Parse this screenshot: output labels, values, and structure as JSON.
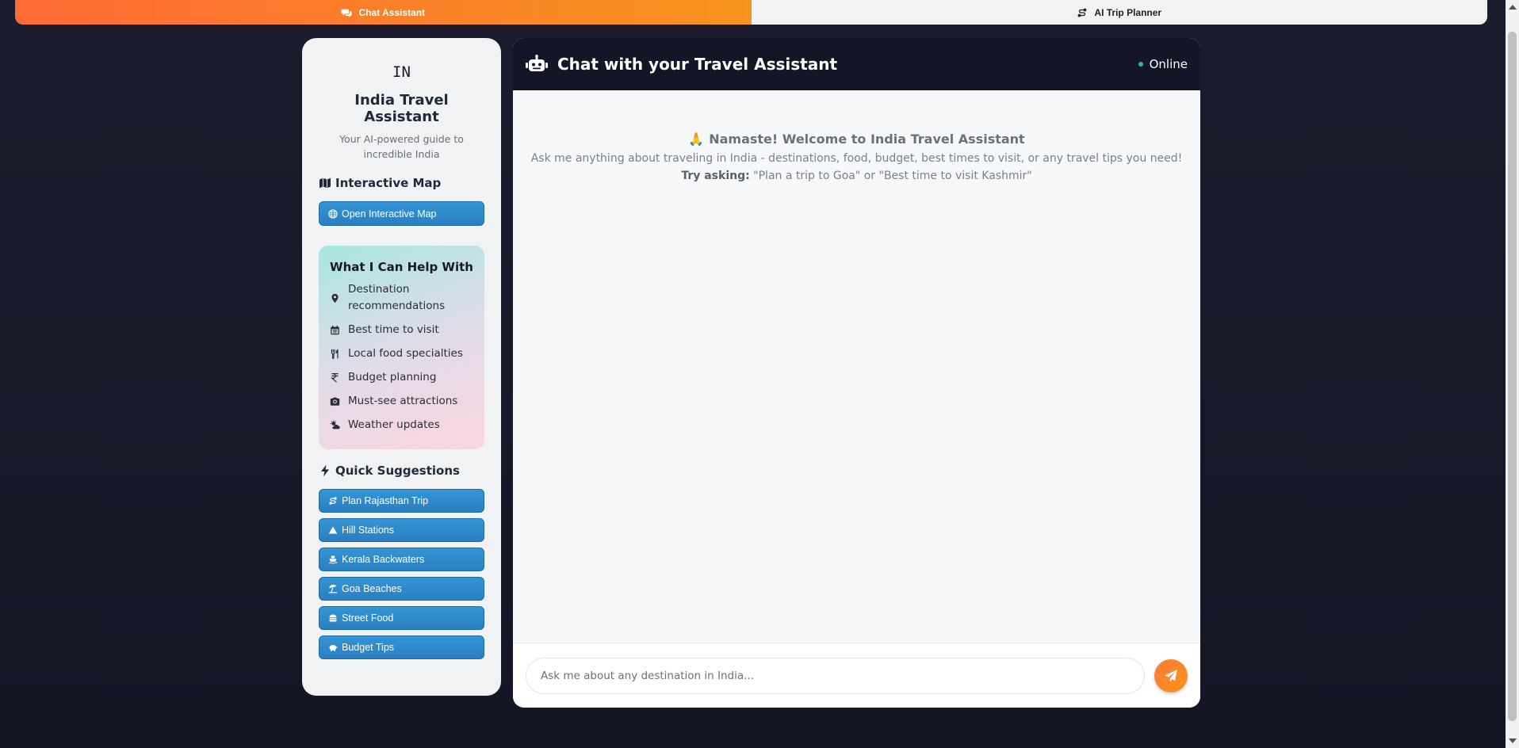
{
  "tabs": [
    {
      "label": "Chat Assistant",
      "icon": "comments-icon",
      "active": true
    },
    {
      "label": "AI Trip Planner",
      "icon": "route-icon",
      "active": false
    }
  ],
  "sidebar": {
    "logo": "IN",
    "title": "India Travel Assistant",
    "subtitle": "Your AI-powered guide to incredible India",
    "map_heading": "Interactive Map",
    "map_button": "Open Interactive Map",
    "help_title": "What I Can Help With",
    "help_items": [
      {
        "icon": "map-pin-icon",
        "label": "Destination recommendations"
      },
      {
        "icon": "calendar-icon",
        "label": "Best time to visit"
      },
      {
        "icon": "utensils-icon",
        "label": "Local food specialties"
      },
      {
        "icon": "rupee-icon",
        "label": "Budget planning"
      },
      {
        "icon": "camera-icon",
        "label": "Must-see attractions"
      },
      {
        "icon": "cloud-sun-icon",
        "label": "Weather updates"
      }
    ],
    "quick_heading": "Quick Suggestions",
    "quick_items": [
      {
        "icon": "route-icon",
        "label": "Plan Rajasthan Trip"
      },
      {
        "icon": "mountain-icon",
        "label": "Hill Stations"
      },
      {
        "icon": "ship-icon",
        "label": "Kerala Backwaters"
      },
      {
        "icon": "umbrella-beach-icon",
        "label": "Goa Beaches"
      },
      {
        "icon": "hamburger-icon",
        "label": "Street Food"
      },
      {
        "icon": "piggy-bank-icon",
        "label": "Budget Tips"
      }
    ]
  },
  "chat": {
    "title": "Chat with your Travel Assistant",
    "status": "Online",
    "welcome_emoji": "🙏",
    "welcome_title": "Namaste! Welcome to India Travel Assistant",
    "welcome_message": "Ask me anything about traveling in India - destinations, food, budget, best times to visit, or any travel tips you need!",
    "try_label": "Try asking:",
    "try_examples": "\"Plan a trip to Goa\" or \"Best time to visit Kashmir\"",
    "input_placeholder": "Ask me about any destination in India...",
    "input_value": ""
  },
  "colors": {
    "accent_orange": "#f7931e",
    "accent_orange_start": "#ff6b35",
    "button_blue": "#2a7fc0",
    "header_dark": "#141627",
    "status_green": "#1abc9c"
  }
}
